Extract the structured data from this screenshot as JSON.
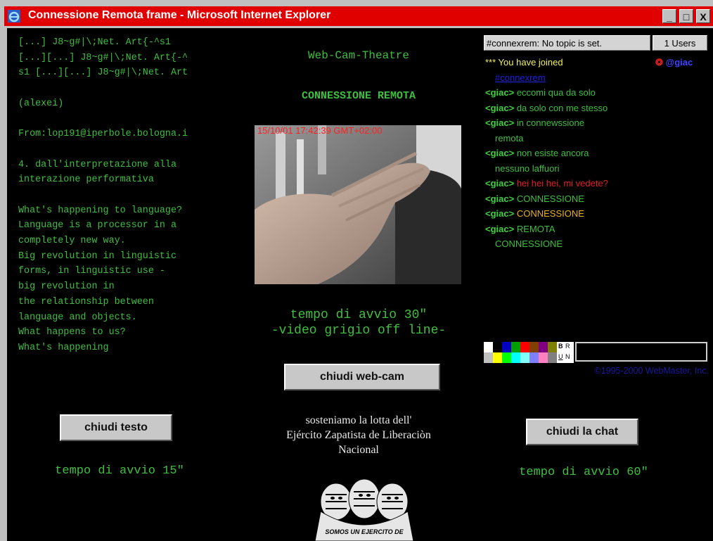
{
  "window": {
    "title": "Connessione Remota frame - Microsoft Internet Explorer",
    "minimize_label": "_",
    "maximize_label": "□",
    "close_label": "X"
  },
  "left": {
    "lines": [
      "[...] J8~g#|\\;Net. Art{-^s1",
      "[...][...] J8~g#|\\;Net. Art{-^",
      "s1 [...][...] J8~g#|\\;Net. Art",
      "",
      "(alexei)",
      "",
      "From:lop191@iperbole.bologna.i",
      "",
      "4. dall'interpretazione alla",
      "interazione performativa",
      "",
      "What's happening to language?",
      "Language is a processor in a",
      "completely new way.",
      "Big revolution in linguistic",
      "forms, in linguistic use -",
      "big revolution in",
      "the relationship between",
      "language and objects.",
      "What happens to us?",
      "What's happening"
    ],
    "close_button": "chiudi testo",
    "start_time": "tempo di avvio 15\""
  },
  "center": {
    "heading": "Web-Cam-Theatre",
    "subheading": "CONNESSIONE REMOTA",
    "timestamp": "15/10/01 17:42:39 GMT+02:00",
    "start_time_1": "tempo di avvio 30\"",
    "start_time_2": "-video grigio off line-",
    "close_button": "chiudi web-cam",
    "support_1": "sosteniamo la lotta dell'",
    "support_2": "Ejército Zapatista de Liberaciòn",
    "support_3": "Nacional",
    "banner_caption": "SOMOS UN EJERCITO DE"
  },
  "chat": {
    "topic": "#connexrem: No topic is set.",
    "users": "1 Users",
    "joined": "*** You have joined",
    "channel": "#connexrem",
    "user_name": "@giac",
    "messages": [
      {
        "nick": "<giac>",
        "text": "eccomi qua da solo",
        "color": "#3fbf3f"
      },
      {
        "nick": "<giac>",
        "text": "da solo con me stesso",
        "color": "#3fbf3f"
      },
      {
        "nick": "<giac>",
        "text": "in connewssione",
        "color": "#3fbf3f",
        "cont": "remota"
      },
      {
        "nick": "<giac>",
        "text": "non esiste ancora",
        "color": "#3fbf3f",
        "cont": "nessuno laffuori"
      },
      {
        "nick": "<giac>",
        "text": "hei hei hei, mi vedete?",
        "color": "#e02020"
      },
      {
        "nick": "<giac>",
        "text": "CONNESSIONE",
        "color": "#3fbf3f"
      },
      {
        "nick": "<giac>",
        "text": "CONNESSIONE",
        "color": "#e8b020"
      },
      {
        "nick": "<giac>",
        "text": "REMOTA",
        "color": "#3fbf3f",
        "cont": "CONNESSIONE"
      }
    ],
    "format_b": "B",
    "format_r": "R",
    "format_u": "U",
    "format_n": "N",
    "copyright": "©1995-2000 WebMaster, Inc.",
    "close_button": "chiudi la chat",
    "start_time": "tempo di avvio 60\"",
    "palette_colors": [
      "#ffffff",
      "#000000",
      "#0000c0",
      "#00a000",
      "#ff0000",
      "#804000",
      "#800080",
      "#808000",
      "#c0c0c0",
      "#ffff00",
      "#00ff00",
      "#00ffff",
      "#80ffff",
      "#8080ff",
      "#ff80c0",
      "#808080"
    ]
  }
}
